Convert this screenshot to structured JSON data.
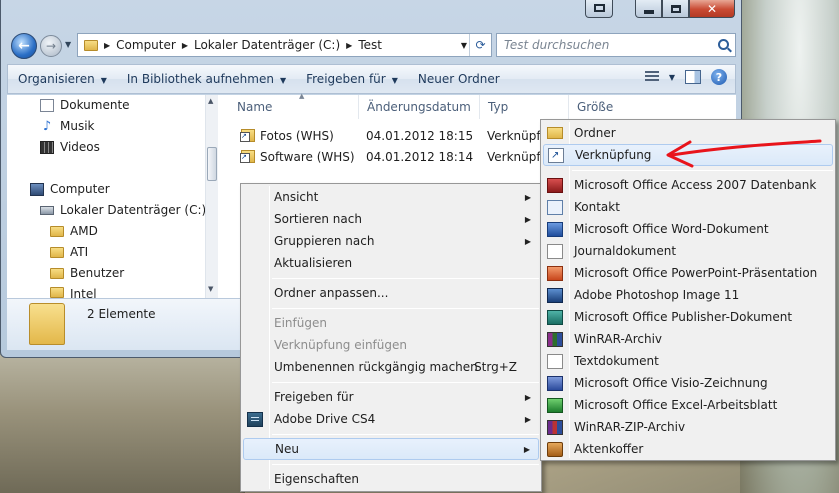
{
  "address": {
    "crumbs": [
      "Computer",
      "Lokaler Datenträger (C:)",
      "Test"
    ]
  },
  "search": {
    "placeholder": "Test durchsuchen"
  },
  "toolbar": {
    "organize": "Organisieren",
    "include_library": "In Bibliothek aufnehmen",
    "share": "Freigeben für",
    "new_folder": "Neuer Ordner"
  },
  "navpane": {
    "items": [
      {
        "label": "Dokumente",
        "icon": "document-icon"
      },
      {
        "label": "Musik",
        "icon": "music-icon"
      },
      {
        "label": "Videos",
        "icon": "video-icon"
      },
      {
        "label": "Computer",
        "icon": "computer-icon"
      },
      {
        "label": "Lokaler Datenträger (C:)",
        "icon": "drive-icon"
      },
      {
        "label": "AMD",
        "icon": "folder-icon"
      },
      {
        "label": "ATI",
        "icon": "folder-icon"
      },
      {
        "label": "Benutzer",
        "icon": "folder-icon"
      },
      {
        "label": "Intel",
        "icon": "folder-icon"
      }
    ]
  },
  "columns": {
    "name": "Name",
    "date": "Änderungsdatum",
    "type": "Typ",
    "size": "Größe"
  },
  "files": [
    {
      "name": "Fotos (WHS)",
      "date": "04.01.2012 18:15",
      "type": "Verknüpfung"
    },
    {
      "name": "Software (WHS)",
      "date": "04.01.2012 18:14",
      "type": "Verknüpfung"
    }
  ],
  "details": {
    "count": "2 Elemente"
  },
  "context_menu": {
    "view": "Ansicht",
    "sort_by": "Sortieren nach",
    "group_by": "Gruppieren nach",
    "refresh": "Aktualisieren",
    "customize": "Ordner anpassen...",
    "paste": "Einfügen",
    "paste_shortcut": "Verknüpfung einfügen",
    "undo_rename": "Umbenennen rückgängig machen",
    "undo_shortcut": "Strg+Z",
    "share_with": "Freigeben für",
    "adobe_drive": "Adobe Drive CS4",
    "new": "Neu",
    "properties": "Eigenschaften"
  },
  "new_submenu": {
    "folder": "Ordner",
    "shortcut": "Verknüpfung",
    "items": [
      {
        "label": "Microsoft Office Access 2007 Datenbank",
        "icon": "access-icon"
      },
      {
        "label": "Kontakt",
        "icon": "contact-icon"
      },
      {
        "label": "Microsoft Office Word-Dokument",
        "icon": "word-icon"
      },
      {
        "label": "Journaldokument",
        "icon": "journal-icon"
      },
      {
        "label": "Microsoft Office PowerPoint-Präsentation",
        "icon": "powerpoint-icon"
      },
      {
        "label": "Adobe Photoshop Image 11",
        "icon": "photoshop-icon"
      },
      {
        "label": "Microsoft Office Publisher-Dokument",
        "icon": "publisher-icon"
      },
      {
        "label": "WinRAR-Archiv",
        "icon": "winrar-icon"
      },
      {
        "label": "Textdokument",
        "icon": "text-document-icon"
      },
      {
        "label": "Microsoft Office Visio-Zeichnung",
        "icon": "visio-icon"
      },
      {
        "label": "Microsoft Office Excel-Arbeitsblatt",
        "icon": "excel-icon"
      },
      {
        "label": "WinRAR-ZIP-Archiv",
        "icon": "zip-archive-icon"
      },
      {
        "label": "Aktenkoffer",
        "icon": "briefcase-icon"
      }
    ]
  },
  "colors": {
    "annotation_arrow": "#e8141b",
    "highlight_border": "#aecbef"
  }
}
